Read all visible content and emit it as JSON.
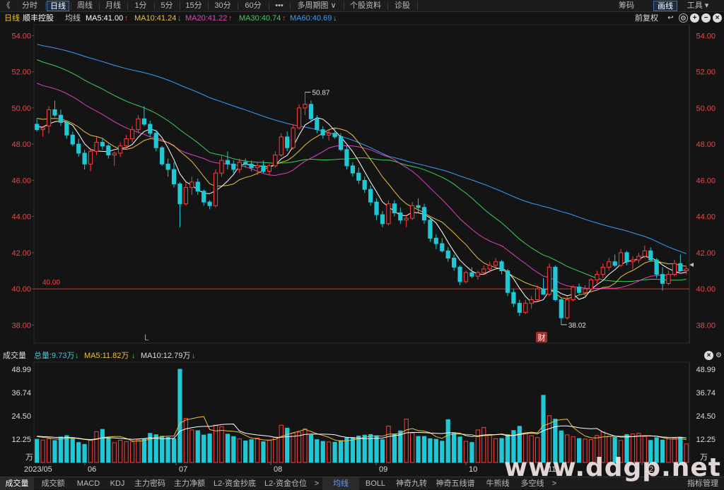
{
  "toolbar": {
    "back": "《",
    "periods": [
      "分时",
      "日线",
      "周线",
      "月线",
      "1分",
      "5分",
      "15分",
      "30分",
      "60分",
      "•••",
      "多周期图 ∨",
      "个股资料",
      "诊股"
    ],
    "selected": "日线",
    "right": [
      "筹码",
      "画线",
      "工具 ▾"
    ],
    "right_selected": "画线"
  },
  "ma_header": {
    "period": "日线",
    "stock": "顺丰控股",
    "avg": "均线",
    "items": [
      {
        "text": "MA5:41.00",
        "arrow": "↑",
        "color": "#ffffff",
        "arrow_color": "#ff4040"
      },
      {
        "text": "MA10:41.24",
        "arrow": "↓",
        "color": "#e8c23a",
        "arrow_color": "#3ad15a"
      },
      {
        "text": "MA20:41.22",
        "arrow": "↑",
        "color": "#e040c0",
        "arrow_color": "#ff4040"
      },
      {
        "text": "MA30:40.74",
        "arrow": "↑",
        "color": "#3ad15a",
        "arrow_color": "#ff4040"
      },
      {
        "text": "MA60:40.69",
        "arrow": "↓",
        "color": "#3a9df5",
        "arrow_color": "#3ad15a"
      }
    ],
    "adjust": "前复权"
  },
  "volume_header": {
    "title": "成交量",
    "total": "总量:9.73万",
    "total_arrow": "↓",
    "ma5": "MA5:11.82万",
    "ma5_arrow": "↓",
    "ma10": "MA10:12.79万",
    "ma10_arrow": "↓"
  },
  "bottom_tabs": [
    "成交量",
    "成交额",
    "MACD",
    "KDJ",
    "主力密码",
    "主力净额",
    "L2-资金抄底",
    "L2-资金仓位",
    ">",
    "均线",
    "BOLL",
    "神奇九转",
    "神奇五线谱",
    "牛熊线",
    "多空线",
    ">",
    "指标管理"
  ],
  "watermark": "www.ddgp.net",
  "chart_data": [
    {
      "type": "candlestick",
      "title": "",
      "y_ticks": [
        "54.00",
        "52.00",
        "50.00",
        "48.00",
        "46.00",
        "44.00",
        "42.00",
        "40.00",
        "38.00"
      ],
      "ylim": [
        37.0,
        54.6
      ],
      "x_ticks": [
        "2023/05",
        "06",
        "07",
        "08",
        "09",
        "10",
        "11",
        "12"
      ],
      "annotations": [
        {
          "text": "50.87",
          "kind": "high"
        },
        {
          "text": "38.02",
          "kind": "low"
        },
        {
          "text": "40.00",
          "kind": "reference_line"
        },
        {
          "text": "L",
          "kind": "marker"
        },
        {
          "text": "财",
          "kind": "marker"
        }
      ],
      "ohlc_approx": [
        [
          49.1,
          49.4,
          48.7,
          48.8
        ],
        [
          48.8,
          49.0,
          48.4,
          48.9
        ],
        [
          49.0,
          50.1,
          48.6,
          49.9
        ],
        [
          49.9,
          50.4,
          49.5,
          49.6
        ],
        [
          49.6,
          49.9,
          49.0,
          49.2
        ],
        [
          49.2,
          49.3,
          48.3,
          48.5
        ],
        [
          48.5,
          48.7,
          47.9,
          48.0
        ],
        [
          48.0,
          48.3,
          47.3,
          47.5
        ],
        [
          47.5,
          47.7,
          46.6,
          46.9
        ],
        [
          46.9,
          47.8,
          46.5,
          47.6
        ],
        [
          47.6,
          48.4,
          47.4,
          48.1
        ],
        [
          48.1,
          48.3,
          47.7,
          47.9
        ],
        [
          47.9,
          48.0,
          47.2,
          47.4
        ],
        [
          47.4,
          47.6,
          46.8,
          47.5
        ],
        [
          47.5,
          48.1,
          47.3,
          47.9
        ],
        [
          47.9,
          48.5,
          47.7,
          48.3
        ],
        [
          48.3,
          49.0,
          48.1,
          48.8
        ],
        [
          48.8,
          49.6,
          48.6,
          49.4
        ],
        [
          49.4,
          50.1,
          49.0,
          49.1
        ],
        [
          49.1,
          49.3,
          48.4,
          48.6
        ],
        [
          48.6,
          48.8,
          47.6,
          47.8
        ],
        [
          47.8,
          47.9,
          46.8,
          46.9
        ],
        [
          46.9,
          47.2,
          46.2,
          46.6
        ],
        [
          46.6,
          47.0,
          45.6,
          45.8
        ],
        [
          45.8,
          45.9,
          43.4,
          44.7
        ],
        [
          44.7,
          45.9,
          44.6,
          45.6
        ],
        [
          45.6,
          46.2,
          45.2,
          45.9
        ],
        [
          45.9,
          46.1,
          45.2,
          45.4
        ],
        [
          45.4,
          45.5,
          44.6,
          44.8
        ],
        [
          44.8,
          44.9,
          44.4,
          44.6
        ],
        [
          44.6,
          46.6,
          44.5,
          46.4
        ],
        [
          46.4,
          47.4,
          46.2,
          47.1
        ],
        [
          47.1,
          47.6,
          46.6,
          46.9
        ],
        [
          46.9,
          47.1,
          46.4,
          46.6
        ],
        [
          46.6,
          47.2,
          46.4,
          47.0
        ],
        [
          47.0,
          47.2,
          46.7,
          46.9
        ],
        [
          46.9,
          47.1,
          46.5,
          46.7
        ],
        [
          46.7,
          47.0,
          46.3,
          46.8
        ],
        [
          46.8,
          47.1,
          46.4,
          46.5
        ],
        [
          46.5,
          46.9,
          46.3,
          46.8
        ],
        [
          46.8,
          47.6,
          46.7,
          47.4
        ],
        [
          47.4,
          48.6,
          47.3,
          48.4
        ],
        [
          48.4,
          48.7,
          47.6,
          47.8
        ],
        [
          47.8,
          49.1,
          47.7,
          48.9
        ],
        [
          48.9,
          50.2,
          48.8,
          50.0
        ],
        [
          50.0,
          50.87,
          49.6,
          50.2
        ],
        [
          50.2,
          50.4,
          49.2,
          49.4
        ],
        [
          49.4,
          49.6,
          48.6,
          48.8
        ],
        [
          48.8,
          49.0,
          48.3,
          48.5
        ],
        [
          48.5,
          48.8,
          48.2,
          48.6
        ],
        [
          48.6,
          48.9,
          48.3,
          48.4
        ],
        [
          48.4,
          48.6,
          47.6,
          47.7
        ],
        [
          47.7,
          47.9,
          46.6,
          46.8
        ],
        [
          46.8,
          47.0,
          46.2,
          46.4
        ],
        [
          46.4,
          46.7,
          45.8,
          46.0
        ],
        [
          46.0,
          46.2,
          45.3,
          45.5
        ],
        [
          45.5,
          45.7,
          44.6,
          44.8
        ],
        [
          44.8,
          45.0,
          43.8,
          44.1
        ],
        [
          44.1,
          44.3,
          43.4,
          43.6
        ],
        [
          43.6,
          44.9,
          43.5,
          44.7
        ],
        [
          44.7,
          44.9,
          44.0,
          44.2
        ],
        [
          44.2,
          44.5,
          43.6,
          43.8
        ],
        [
          43.8,
          44.1,
          43.4,
          43.9
        ],
        [
          43.9,
          44.8,
          43.8,
          44.6
        ],
        [
          44.6,
          45.0,
          44.2,
          44.5
        ],
        [
          44.5,
          44.7,
          43.6,
          43.8
        ],
        [
          43.8,
          43.9,
          42.6,
          42.8
        ],
        [
          42.8,
          43.0,
          42.2,
          42.5
        ],
        [
          42.5,
          42.8,
          42.0,
          42.1
        ],
        [
          42.1,
          42.3,
          41.5,
          41.7
        ],
        [
          41.7,
          41.9,
          41.0,
          41.2
        ],
        [
          41.2,
          41.3,
          40.2,
          40.4
        ],
        [
          40.4,
          41.0,
          40.3,
          40.9
        ],
        [
          40.9,
          41.2,
          40.6,
          40.7
        ],
        [
          40.7,
          41.0,
          40.5,
          40.9
        ],
        [
          40.9,
          41.3,
          40.8,
          41.1
        ],
        [
          41.1,
          41.5,
          40.9,
          41.3
        ],
        [
          41.3,
          41.7,
          41.1,
          41.5
        ],
        [
          41.5,
          41.6,
          40.8,
          41.0
        ],
        [
          41.0,
          41.1,
          39.6,
          39.8
        ],
        [
          39.8,
          40.0,
          39.0,
          39.2
        ],
        [
          39.2,
          39.4,
          38.5,
          38.7
        ],
        [
          38.7,
          39.4,
          38.6,
          39.2
        ],
        [
          39.2,
          39.6,
          38.9,
          39.4
        ],
        [
          39.4,
          40.2,
          39.3,
          40.0
        ],
        [
          40.0,
          40.6,
          39.8,
          39.7
        ],
        [
          39.7,
          41.4,
          39.6,
          41.2
        ],
        [
          41.2,
          41.3,
          39.3,
          39.4
        ],
        [
          39.4,
          39.5,
          38.02,
          38.4
        ],
        [
          38.4,
          39.6,
          38.3,
          39.4
        ],
        [
          39.4,
          40.2,
          39.3,
          40.1
        ],
        [
          40.1,
          40.3,
          39.7,
          39.8
        ],
        [
          39.8,
          40.2,
          39.6,
          40.0
        ],
        [
          40.0,
          40.6,
          39.9,
          40.5
        ],
        [
          40.5,
          41.0,
          40.3,
          40.8
        ],
        [
          40.8,
          41.4,
          40.6,
          41.2
        ],
        [
          41.2,
          41.7,
          41.0,
          41.5
        ],
        [
          41.5,
          41.9,
          41.2,
          41.3
        ],
        [
          41.3,
          42.2,
          41.2,
          42.0
        ],
        [
          42.0,
          42.1,
          41.3,
          41.5
        ],
        [
          41.5,
          41.8,
          41.1,
          41.6
        ],
        [
          41.6,
          42.0,
          41.4,
          41.8
        ],
        [
          41.8,
          42.4,
          41.7,
          42.1
        ],
        [
          42.1,
          42.3,
          41.5,
          41.6
        ],
        [
          41.6,
          41.7,
          40.6,
          40.8
        ],
        [
          40.8,
          41.2,
          39.9,
          40.3
        ],
        [
          40.3,
          41.0,
          40.2,
          40.8
        ],
        [
          40.8,
          41.6,
          40.7,
          41.4
        ],
        [
          41.4,
          41.9,
          41.1,
          41.0
        ],
        [
          41.0,
          41.2,
          40.8,
          41.1
        ]
      ],
      "ma_series": [
        {
          "name": "MA5",
          "color": "#ffffff",
          "last": 41.0
        },
        {
          "name": "MA10",
          "color": "#e8c23a",
          "last": 41.24
        },
        {
          "name": "MA20",
          "color": "#e040c0",
          "last": 41.22
        },
        {
          "name": "MA30",
          "color": "#3ad15a",
          "last": 40.74
        },
        {
          "name": "MA60",
          "color": "#3a9df5",
          "last": 40.69
        }
      ]
    },
    {
      "type": "bar",
      "title": "",
      "y_ticks": [
        "48.99",
        "36.74",
        "24.50",
        "12.25"
      ],
      "ylim": [
        0,
        48.99
      ],
      "unit_label": "万",
      "values_approx": [
        12.2,
        11.8,
        12.5,
        11.5,
        13.4,
        14.1,
        13.0,
        10.5,
        9.5,
        11.6,
        16.2,
        17.4,
        12.6,
        10.4,
        11.7,
        11.0,
        10.9,
        11.9,
        12.3,
        15.3,
        14.6,
        13.8,
        13.2,
        12.5,
        48.99,
        23.2,
        17.1,
        16.7,
        14.4,
        15.0,
        19.6,
        18.8,
        14.9,
        13.6,
        12.4,
        11.3,
        12.0,
        12.8,
        10.9,
        11.6,
        13.3,
        19.6,
        18.0,
        15.4,
        15.9,
        17.7,
        14.4,
        12.0,
        11.1,
        10.8,
        10.6,
        11.5,
        12.9,
        13.1,
        13.9,
        14.4,
        14.7,
        14.0,
        12.0,
        19.1,
        15.0,
        16.6,
        22.8,
        15.5,
        13.7,
        13.7,
        12.5,
        12.2,
        11.2,
        22.5,
        15.6,
        13.4,
        11.1,
        10.5,
        17.1,
        18.4,
        14.3,
        12.5,
        12.6,
        14.6,
        16.8,
        19.0,
        15.2,
        14.1,
        13.1,
        35.3,
        24.6,
        22.8,
        16.6,
        14.5,
        13.5,
        12.6,
        12.3,
        12.0,
        14.2,
        16.0,
        13.8,
        13.2,
        11.6,
        14.7,
        15.0,
        15.3,
        13.7,
        11.6,
        13.0,
        11.8,
        12.4,
        12.7,
        13.1,
        9.73
      ],
      "ma_series": [
        {
          "name": "MA5",
          "color": "#e8c23a",
          "last": 11.82
        },
        {
          "name": "MA10",
          "color": "#ffffff",
          "last": 12.79
        }
      ]
    }
  ]
}
